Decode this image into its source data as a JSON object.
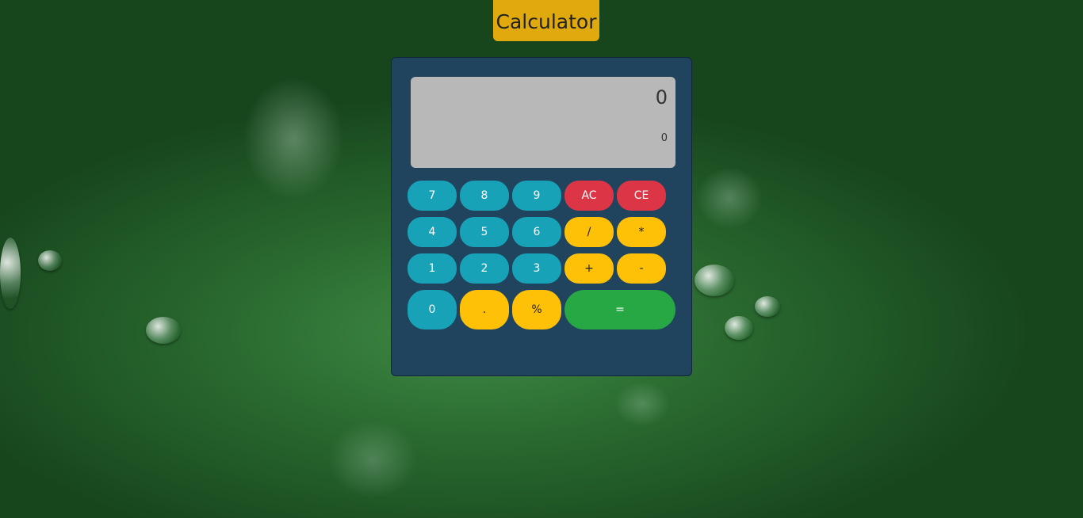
{
  "header": {
    "title": "Calculator"
  },
  "display": {
    "current": "0",
    "previous": "0"
  },
  "keys": {
    "k7": "7",
    "k8": "8",
    "k9": "9",
    "ac": "AC",
    "ce": "CE",
    "k4": "4",
    "k5": "5",
    "k6": "6",
    "div": "/",
    "mul": "*",
    "k1": "1",
    "k2": "2",
    "k3": "3",
    "add": "+",
    "sub": "-",
    "k0": "0",
    "dot": ".",
    "pct": "%",
    "eq": "="
  },
  "colors": {
    "number_key": "#17a2b8",
    "operator_key": "#ffc107",
    "clear_key": "#dc3545",
    "equals_key": "#28a745",
    "panel": "#21445e",
    "title_bg": "#e0aa0f"
  }
}
